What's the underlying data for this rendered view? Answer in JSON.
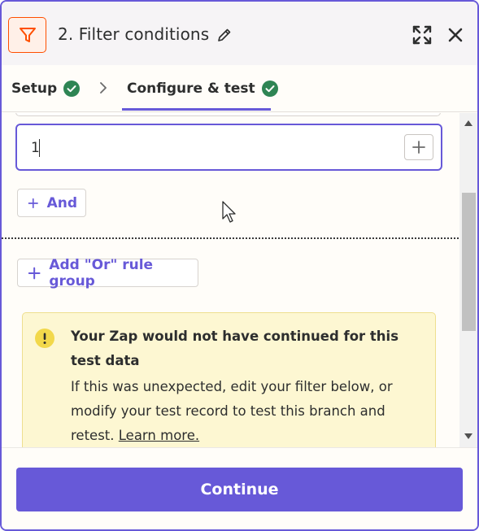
{
  "header": {
    "title": "2. Filter conditions",
    "app_icon": "filter-icon",
    "accent": "#ff4f00"
  },
  "tabs": [
    {
      "label": "Setup",
      "status": "complete"
    },
    {
      "label": "Configure & test",
      "status": "complete",
      "active": true
    }
  ],
  "condition": {
    "value": "1"
  },
  "buttons": {
    "and_label": "And",
    "or_group_label": "Add \"Or\" rule group",
    "continue_label": "Continue"
  },
  "warning": {
    "title": "Your Zap would not have continued for this test data",
    "body": "If this was unexpected, edit your filter below, or modify your test record to test this branch and retest.",
    "link": "Learn more."
  },
  "colors": {
    "primary": "#6759d8",
    "success": "#2e8554",
    "warning_bg": "#fdf7d2",
    "warning_icon": "#f2d84b"
  }
}
